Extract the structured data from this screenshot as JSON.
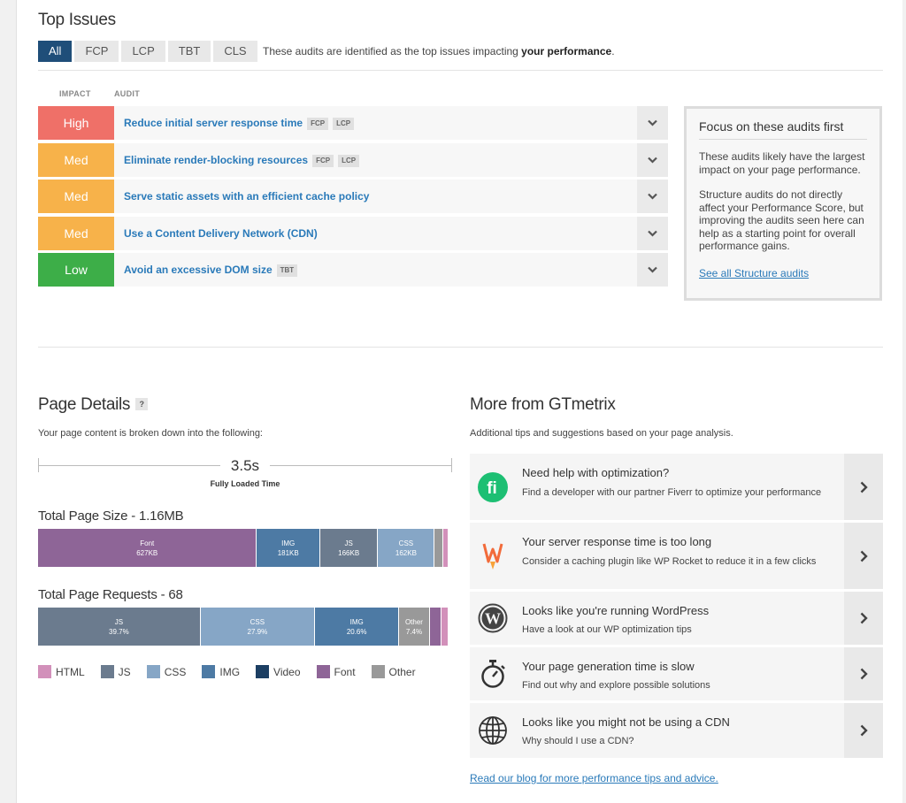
{
  "top_issues": {
    "title": "Top Issues",
    "tabs": [
      {
        "label": "All",
        "active": true
      },
      {
        "label": "FCP",
        "active": false
      },
      {
        "label": "LCP",
        "active": false
      },
      {
        "label": "TBT",
        "active": false
      },
      {
        "label": "CLS",
        "active": false
      }
    ],
    "note_prefix": "These audits are identified as the top issues impacting ",
    "note_bold": "your performance",
    "note_suffix": ".",
    "col_impact": "IMPACT",
    "col_audit": "AUDIT",
    "issues": [
      {
        "impact": "High",
        "level": "high",
        "name": "Reduce initial server response time",
        "tags": [
          "FCP",
          "LCP"
        ]
      },
      {
        "impact": "Med",
        "level": "med",
        "name": "Eliminate render-blocking resources",
        "tags": [
          "FCP",
          "LCP"
        ]
      },
      {
        "impact": "Med",
        "level": "med",
        "name": "Serve static assets with an efficient cache policy",
        "tags": []
      },
      {
        "impact": "Med",
        "level": "med",
        "name": "Use a Content Delivery Network (CDN)",
        "tags": []
      },
      {
        "impact": "Low",
        "level": "low",
        "name": "Avoid an excessive DOM size",
        "tags": [
          "TBT"
        ]
      }
    ],
    "focus": {
      "title": "Focus on these audits first",
      "p1": "These audits likely have the largest impact on your page performance.",
      "p2": "Structure audits do not directly affect your Performance Score, but improving the audits seen here can help as a starting point for overall performance gains.",
      "link": "See all Structure audits"
    }
  },
  "page_details": {
    "title": "Page Details",
    "help": "?",
    "subtitle": "Your page content is broken down into the following:",
    "fully_loaded_value": "3.5s",
    "fully_loaded_label": "Fully Loaded Time",
    "size_title": "Total Page Size - 1.16MB",
    "requests_title": "Total Page Requests - 68"
  },
  "chart_data": [
    {
      "type": "bar",
      "title": "Total Page Size - 1.16MB",
      "stacked": true,
      "unit": "KB",
      "segments": [
        {
          "name": "Font",
          "label": "627KB",
          "value": 627,
          "color": "#8e6597"
        },
        {
          "name": "IMG",
          "label": "181KB",
          "value": 181,
          "color": "#4d7aa4"
        },
        {
          "name": "JS",
          "label": "166KB",
          "value": 166,
          "color": "#6b7b8e"
        },
        {
          "name": "CSS",
          "label": "162KB",
          "value": 162,
          "color": "#86a6c6"
        },
        {
          "name": "Other",
          "label": "",
          "value": 24,
          "color": "#999999"
        },
        {
          "name": "HTML",
          "label": "",
          "value": 13,
          "color": "#d290ba"
        }
      ]
    },
    {
      "type": "bar",
      "title": "Total Page Requests - 68",
      "stacked": true,
      "unit": "%",
      "segments": [
        {
          "name": "JS",
          "label": "39.7%",
          "value": 39.7,
          "color": "#6b7b8e"
        },
        {
          "name": "CSS",
          "label": "27.9%",
          "value": 27.9,
          "color": "#86a6c6"
        },
        {
          "name": "IMG",
          "label": "20.6%",
          "value": 20.6,
          "color": "#4d7aa4"
        },
        {
          "name": "Other",
          "label": "7.4%",
          "value": 7.4,
          "color": "#999999"
        },
        {
          "name": "Font",
          "label": "",
          "value": 2.9,
          "color": "#8e6597"
        },
        {
          "name": "HTML",
          "label": "",
          "value": 1.5,
          "color": "#d290ba"
        }
      ]
    }
  ],
  "legend": [
    {
      "label": "HTML",
      "color": "#d290ba"
    },
    {
      "label": "JS",
      "color": "#6b7b8e"
    },
    {
      "label": "CSS",
      "color": "#86a6c6"
    },
    {
      "label": "IMG",
      "color": "#4d7aa4"
    },
    {
      "label": "Video",
      "color": "#1c3f63"
    },
    {
      "label": "Font",
      "color": "#8e6597"
    },
    {
      "label": "Other",
      "color": "#999999"
    }
  ],
  "more": {
    "title": "More from GTmetrix",
    "subtitle": "Additional tips and suggestions based on your page analysis.",
    "tips": [
      {
        "icon": "fiverr-icon",
        "title": "Need help with optimization?",
        "desc": "Find a developer with our partner Fiverr to optimize your performance"
      },
      {
        "icon": "wp-rocket-icon",
        "title": "Your server response time is too long",
        "desc": "Consider a caching plugin like WP Rocket to reduce it in a few clicks"
      },
      {
        "icon": "wordpress-icon",
        "title": "Looks like you're running WordPress",
        "desc": "Have a look at our WP optimization tips"
      },
      {
        "icon": "stopwatch-icon",
        "title": "Your page generation time is slow",
        "desc": "Find out why and explore possible solutions"
      },
      {
        "icon": "globe-icon",
        "title": "Looks like you might not be using a CDN",
        "desc": "Why should I use a CDN?"
      }
    ],
    "blog_link": "Read our blog for more performance tips and advice."
  }
}
